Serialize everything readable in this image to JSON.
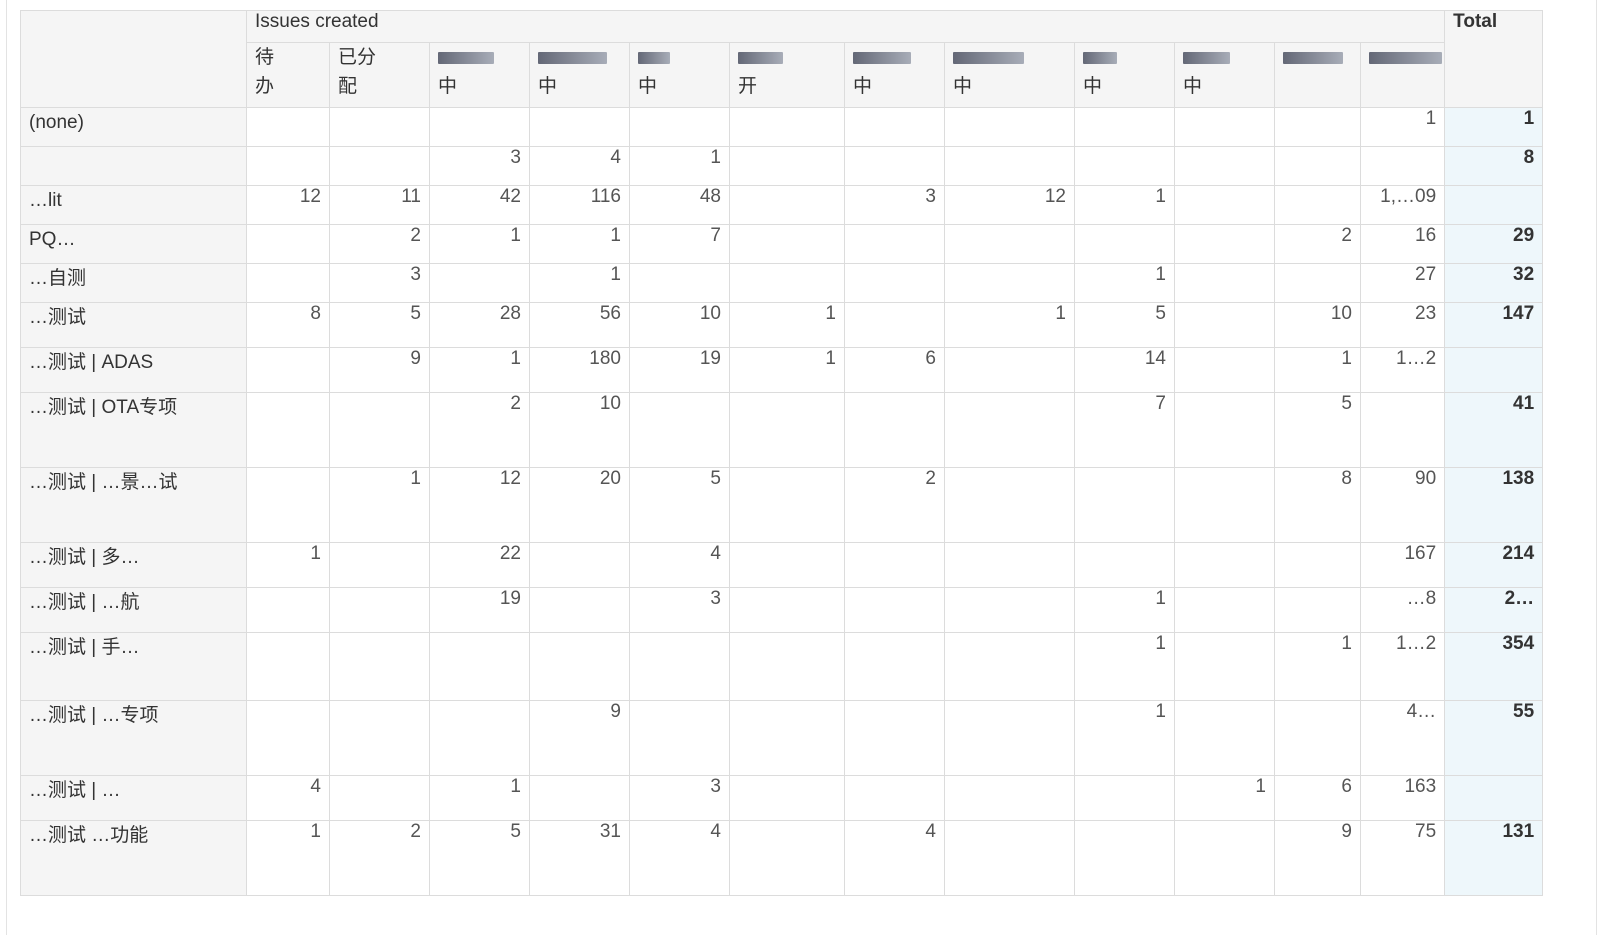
{
  "table": {
    "group_header": "Issues created",
    "total_header": "Total",
    "columns": [
      {
        "label": "待\n办"
      },
      {
        "label": "已分\n配"
      },
      {
        "label": "中",
        "obscured": true
      },
      {
        "label": "中",
        "obscured": true
      },
      {
        "label": "中",
        "obscured": true
      },
      {
        "label": "开",
        "obscured": true
      },
      {
        "label": "中",
        "obscured": true
      },
      {
        "label": "中",
        "obscured": true
      },
      {
        "label": "中",
        "obscured": true
      },
      {
        "label": "中",
        "obscured": true
      },
      {
        "label": "",
        "obscured": true
      },
      {
        "label": "",
        "obscured": true
      }
    ],
    "rows": [
      {
        "label": "(none)",
        "cells": [
          "",
          "",
          "",
          "",
          "",
          "",
          "",
          "",
          "",
          "",
          "",
          "1"
        ],
        "total": "1"
      },
      {
        "label": "",
        "cells": [
          "",
          "",
          "3",
          "4",
          "1",
          "",
          "",
          "",
          "",
          "",
          "",
          ""
        ],
        "total": "8"
      },
      {
        "label": "…lit",
        "cells": [
          "12",
          "11",
          "42",
          "116",
          "48",
          "",
          "3",
          "12",
          "1",
          "",
          "",
          "1,…09"
        ],
        "total": ""
      },
      {
        "label": "PQ…",
        "cells": [
          "",
          "2",
          "1",
          "1",
          "7",
          "",
          "",
          "",
          "",
          "",
          "2",
          "16"
        ],
        "total": "29"
      },
      {
        "label": "…自测",
        "cells": [
          "",
          "3",
          "",
          "1",
          "",
          "",
          "",
          "",
          "1",
          "",
          "",
          "27"
        ],
        "total": "32"
      },
      {
        "label": "…测试",
        "cells": [
          "8",
          "5",
          "28",
          "56",
          "10",
          "1",
          "",
          "1",
          "5",
          "",
          "10",
          "23"
        ],
        "total": "147"
      },
      {
        "label": "…测试 | ADAS",
        "cells": [
          "",
          "9",
          "1",
          "180",
          "19",
          "1",
          "6",
          "",
          "14",
          "",
          "1",
          "1…2"
        ],
        "total": ""
      },
      {
        "label": "…测试 | OTA专项",
        "cells": [
          "",
          "",
          "2",
          "10",
          "",
          "",
          "",
          "",
          "7",
          "",
          "5",
          ""
        ],
        "total": "41"
      },
      {
        "label": "…测试 | …景…试",
        "cells": [
          "",
          "1",
          "12",
          "20",
          "5",
          "",
          "2",
          "",
          "",
          "",
          "8",
          "90"
        ],
        "total": "138"
      },
      {
        "label": "…测试 | 多…",
        "cells": [
          "1",
          "",
          "22",
          "",
          "4",
          "",
          "",
          "",
          "",
          "",
          "",
          "167"
        ],
        "total": "214"
      },
      {
        "label": "…测试 | …航",
        "cells": [
          "",
          "",
          "19",
          "",
          "3",
          "",
          "",
          "",
          "1",
          "",
          "",
          "…8"
        ],
        "total": "2…"
      },
      {
        "label": "…测试 | 手…",
        "cells": [
          "",
          "",
          "",
          "",
          "",
          "",
          "",
          "",
          "1",
          "",
          "1",
          "1…2"
        ],
        "total": "354"
      },
      {
        "label": "…测试 | …专项",
        "cells": [
          "",
          "",
          "",
          "9",
          "",
          "",
          "",
          "",
          "1",
          "",
          "",
          "4…"
        ],
        "total": "55"
      },
      {
        "label": "…测试 | …",
        "cells": [
          "4",
          "",
          "1",
          "",
          "3",
          "",
          "",
          "",
          "",
          "1",
          "6",
          "163"
        ],
        "total": ""
      },
      {
        "label": "…测试 …功能",
        "cells": [
          "1",
          "2",
          "5",
          "31",
          "4",
          "",
          "4",
          "",
          "",
          "",
          "9",
          "75"
        ],
        "total": "131"
      }
    ]
  },
  "colors": {
    "header_bg": "#f5f5f5",
    "total_bg": "#eef7fb",
    "border": "#dcdcdc"
  }
}
